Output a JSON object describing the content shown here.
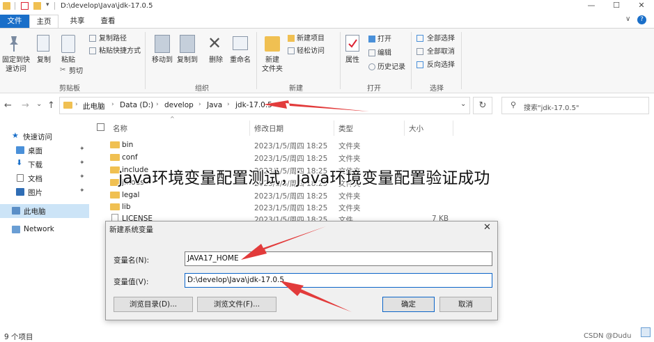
{
  "window": {
    "title": "D:\\develop\\Java\\jdk-17.0.5",
    "qa_arrow": "▾",
    "minimize": "—",
    "maximize": "☐",
    "close": "✕"
  },
  "ribbon": {
    "tabs": [
      "文件",
      "主页",
      "共享",
      "查看"
    ],
    "toggle": "∨",
    "help": "?",
    "clipboard": {
      "pin_label_1": "固定到快",
      "pin_label_2": "速访问",
      "copy": "复制",
      "paste": "粘贴",
      "copy_path": "复制路径",
      "paste_shortcut": "粘贴快捷方式",
      "cut": "剪切",
      "group": "剪贴板"
    },
    "organize": {
      "move_to": "移动到",
      "copy_to": "复制到",
      "delete": "删除",
      "rename": "重命名",
      "group": "组织"
    },
    "new": {
      "new_folder_1": "新建",
      "new_folder_2": "文件夹",
      "new_item": "新建项目",
      "easy_access": "轻松访问",
      "group": "新建"
    },
    "open": {
      "properties": "属性",
      "open": "打开",
      "edit": "编辑",
      "history": "历史记录",
      "group": "打开"
    },
    "select": {
      "select_all": "全部选择",
      "select_none": "全部取消",
      "invert": "反向选择",
      "group": "选择"
    }
  },
  "address": {
    "back": "←",
    "forward": "→",
    "recent": "⌄",
    "up": "↑",
    "crumbs": [
      "此电脑",
      "Data (D:)",
      "develop",
      "Java",
      "jdk-17.0.5"
    ],
    "crumb_sep": "›",
    "dropdown": "⌄",
    "refresh": "↻",
    "search_placeholder": "搜索\"jdk-17.0.5\""
  },
  "nav": {
    "quick_access": "快速访问",
    "desktop": "桌面",
    "downloads": "下载",
    "documents": "文档",
    "pictures": "图片",
    "this_pc": "此电脑",
    "network": "Network",
    "pin": "✦"
  },
  "columns": {
    "name": "名称",
    "date": "修改日期",
    "type": "类型",
    "size": "大小",
    "sort_caret": "^"
  },
  "files": [
    {
      "name": "bin",
      "date": "2023/1/5/周四 18:25",
      "type": "文件夹",
      "size": ""
    },
    {
      "name": "conf",
      "date": "2023/1/5/周四 18:25",
      "type": "文件夹",
      "size": ""
    },
    {
      "name": "include",
      "date": "2023/1/5/周四 18:25",
      "type": "文件夹",
      "size": ""
    },
    {
      "name": "jmods",
      "date": "2023/1/5/周四 18:25",
      "type": "文件夹",
      "size": ""
    },
    {
      "name": "legal",
      "date": "2023/1/5/周四 18:25",
      "type": "文件夹",
      "size": ""
    },
    {
      "name": "lib",
      "date": "2023/1/5/周四 18:25",
      "type": "文件夹",
      "size": ""
    },
    {
      "name": "LICENSE",
      "date": "2023/1/5/周四 18:25",
      "type": "文件",
      "size": "7 KB"
    }
  ],
  "status": "9 个项目",
  "overlay_text": "java环境变量配置测试，java环境变量配置验证成功",
  "dialog": {
    "title": "新建系统变量",
    "close": "✕",
    "name_label": "变量名(N):",
    "value_label": "变量值(V):",
    "name_value": "JAVA17_HOME",
    "value_value": "D:\\develop\\Java\\jdk-17.0.5",
    "browse_dir": "浏览目录(D)...",
    "browse_file": "浏览文件(F)...",
    "ok": "确定",
    "cancel": "取消"
  },
  "watermark": "CSDN @Dudu",
  "colors": {
    "accent": "#1a6fc9",
    "arrow": "#e23b3b",
    "folder": "#f0c052",
    "selection": "#cce4f7"
  }
}
